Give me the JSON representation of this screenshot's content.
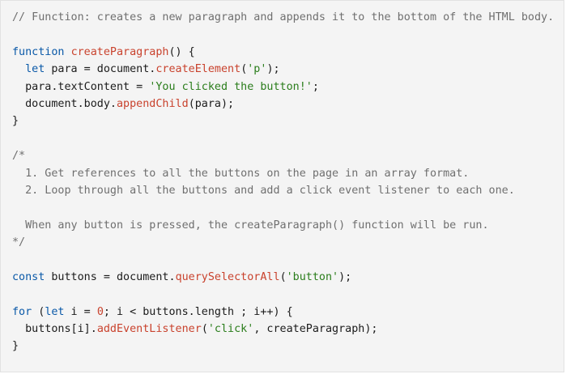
{
  "code_view": {
    "language": "javascript",
    "colors": {
      "background": "#f4f4f4",
      "comment": "#6f6f6f",
      "keyword": "#0a59a8",
      "function": "#c9422d",
      "string": "#2a7d1b",
      "number": "#c9422d",
      "plain": "#1b1b1b"
    },
    "lines": [
      [
        {
          "t": "cm",
          "v": "// Function: creates a new paragraph and appends it to the bottom of the HTML body."
        }
      ],
      [],
      [
        {
          "t": "kw",
          "v": "function"
        },
        {
          "t": "pl",
          "v": " "
        },
        {
          "t": "fn",
          "v": "createParagraph"
        },
        {
          "t": "pl",
          "v": "() {"
        }
      ],
      [
        {
          "t": "pl",
          "v": "  "
        },
        {
          "t": "kw",
          "v": "let"
        },
        {
          "t": "pl",
          "v": " para = document."
        },
        {
          "t": "fn",
          "v": "createElement"
        },
        {
          "t": "pl",
          "v": "("
        },
        {
          "t": "st",
          "v": "'p'"
        },
        {
          "t": "pl",
          "v": ");"
        }
      ],
      [
        {
          "t": "pl",
          "v": "  para.textContent = "
        },
        {
          "t": "st",
          "v": "'You clicked the button!'"
        },
        {
          "t": "pl",
          "v": ";"
        }
      ],
      [
        {
          "t": "pl",
          "v": "  document.body."
        },
        {
          "t": "fn",
          "v": "appendChild"
        },
        {
          "t": "pl",
          "v": "(para);"
        }
      ],
      [
        {
          "t": "pl",
          "v": "}"
        }
      ],
      [],
      [
        {
          "t": "cm",
          "v": "/*"
        }
      ],
      [
        {
          "t": "cm",
          "v": "  1. Get references to all the buttons on the page in an array format."
        }
      ],
      [
        {
          "t": "cm",
          "v": "  2. Loop through all the buttons and add a click event listener to each one."
        }
      ],
      [],
      [
        {
          "t": "cm",
          "v": "  When any button is pressed, the createParagraph() function will be run."
        }
      ],
      [
        {
          "t": "cm",
          "v": "*/"
        }
      ],
      [],
      [
        {
          "t": "kw",
          "v": "const"
        },
        {
          "t": "pl",
          "v": " buttons = document."
        },
        {
          "t": "fn",
          "v": "querySelectorAll"
        },
        {
          "t": "pl",
          "v": "("
        },
        {
          "t": "st",
          "v": "'button'"
        },
        {
          "t": "pl",
          "v": ");"
        }
      ],
      [],
      [
        {
          "t": "kw",
          "v": "for"
        },
        {
          "t": "pl",
          "v": " ("
        },
        {
          "t": "kw",
          "v": "let"
        },
        {
          "t": "pl",
          "v": " i = "
        },
        {
          "t": "nm",
          "v": "0"
        },
        {
          "t": "pl",
          "v": "; i < buttons.length ; i++) {"
        }
      ],
      [
        {
          "t": "pl",
          "v": "  buttons[i]."
        },
        {
          "t": "fn",
          "v": "addEventListener"
        },
        {
          "t": "pl",
          "v": "("
        },
        {
          "t": "st",
          "v": "'click'"
        },
        {
          "t": "pl",
          "v": ", createParagraph);"
        }
      ],
      [
        {
          "t": "pl",
          "v": "}"
        }
      ]
    ]
  }
}
